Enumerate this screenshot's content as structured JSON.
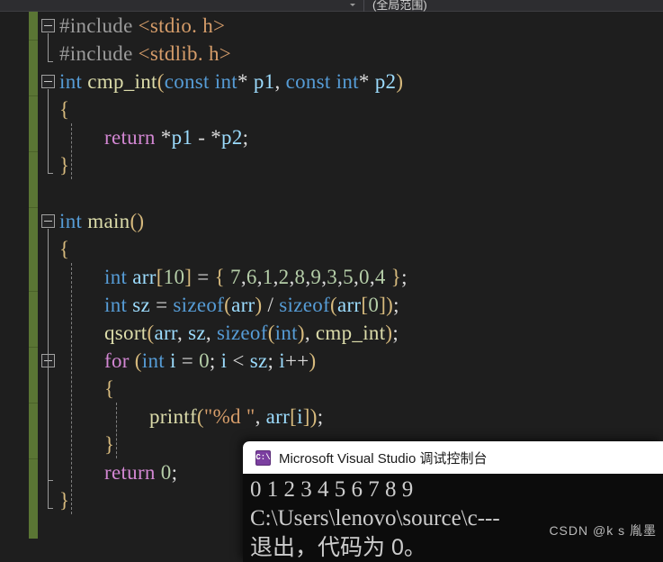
{
  "window": {
    "app": "Microsoft Visual Studio",
    "theme_background": "#1e1e1e"
  },
  "toolbar": {
    "scope_label": "(全局范围)",
    "dropdown_icon": "chevron-down-icon"
  },
  "editor": {
    "change_bar_color": "#5a7534",
    "font_size_px": 23,
    "line_height_px": 31,
    "lines": [
      {
        "n": 1,
        "indent": 0,
        "fold": "open",
        "tokens": [
          {
            "t": "pre",
            "v": "#include "
          },
          {
            "t": "str",
            "v": "<stdio. h>"
          }
        ]
      },
      {
        "n": 2,
        "indent": 0,
        "fold": "none",
        "tokens": [
          {
            "t": "pre",
            "v": "#include "
          },
          {
            "t": "str",
            "v": "<stdlib. h>"
          }
        ]
      },
      {
        "n": 3,
        "indent": 0,
        "fold": "open",
        "tokens": [
          {
            "t": "kw",
            "v": "int"
          },
          {
            "t": "plain",
            "v": " "
          },
          {
            "t": "fn",
            "v": "cmp_int"
          },
          {
            "t": "brace",
            "v": "("
          },
          {
            "t": "kw",
            "v": "const int"
          },
          {
            "t": "plain",
            "v": "* "
          },
          {
            "t": "var",
            "v": "p1"
          },
          {
            "t": "punct",
            "v": ", "
          },
          {
            "t": "kw",
            "v": "const int"
          },
          {
            "t": "plain",
            "v": "* "
          },
          {
            "t": "var",
            "v": "p2"
          },
          {
            "t": "brace",
            "v": ")"
          }
        ]
      },
      {
        "n": 4,
        "indent": 0,
        "fold": "none",
        "tokens": [
          {
            "t": "brace",
            "v": "{"
          }
        ]
      },
      {
        "n": 5,
        "indent": 1,
        "fold": "none",
        "tokens": [
          {
            "t": "ctl",
            "v": "return"
          },
          {
            "t": "plain",
            "v": " *"
          },
          {
            "t": "var",
            "v": "p1"
          },
          {
            "t": "plain",
            "v": " - *"
          },
          {
            "t": "var",
            "v": "p2"
          },
          {
            "t": "punct",
            "v": ";"
          }
        ]
      },
      {
        "n": 6,
        "indent": 0,
        "fold": "none",
        "tokens": [
          {
            "t": "brace",
            "v": "}"
          }
        ]
      },
      {
        "n": 7,
        "indent": 0,
        "fold": "none",
        "tokens": []
      },
      {
        "n": 8,
        "indent": 0,
        "fold": "open",
        "tokens": [
          {
            "t": "kw",
            "v": "int"
          },
          {
            "t": "plain",
            "v": " "
          },
          {
            "t": "fn",
            "v": "main"
          },
          {
            "t": "brace",
            "v": "()"
          }
        ]
      },
      {
        "n": 9,
        "indent": 0,
        "fold": "none",
        "tokens": [
          {
            "t": "brace",
            "v": "{"
          }
        ]
      },
      {
        "n": 10,
        "indent": 1,
        "fold": "none",
        "tokens": [
          {
            "t": "kw",
            "v": "int"
          },
          {
            "t": "plain",
            "v": " "
          },
          {
            "t": "var",
            "v": "arr"
          },
          {
            "t": "brace",
            "v": "["
          },
          {
            "t": "num",
            "v": "10"
          },
          {
            "t": "brace",
            "v": "]"
          },
          {
            "t": "plain",
            "v": " = "
          },
          {
            "t": "brace",
            "v": "{"
          },
          {
            "t": "plain",
            "v": " "
          },
          {
            "t": "num",
            "v": "7"
          },
          {
            "t": "punct",
            "v": ","
          },
          {
            "t": "num",
            "v": "6"
          },
          {
            "t": "punct",
            "v": ","
          },
          {
            "t": "num",
            "v": "1"
          },
          {
            "t": "punct",
            "v": ","
          },
          {
            "t": "num",
            "v": "2"
          },
          {
            "t": "punct",
            "v": ","
          },
          {
            "t": "num",
            "v": "8"
          },
          {
            "t": "punct",
            "v": ","
          },
          {
            "t": "num",
            "v": "9"
          },
          {
            "t": "punct",
            "v": ","
          },
          {
            "t": "num",
            "v": "3"
          },
          {
            "t": "punct",
            "v": ","
          },
          {
            "t": "num",
            "v": "5"
          },
          {
            "t": "punct",
            "v": ","
          },
          {
            "t": "num",
            "v": "0"
          },
          {
            "t": "punct",
            "v": ","
          },
          {
            "t": "num",
            "v": "4"
          },
          {
            "t": "plain",
            "v": " "
          },
          {
            "t": "brace",
            "v": "}"
          },
          {
            "t": "punct",
            "v": ";"
          }
        ]
      },
      {
        "n": 11,
        "indent": 1,
        "fold": "none",
        "tokens": [
          {
            "t": "kw",
            "v": "int"
          },
          {
            "t": "plain",
            "v": " "
          },
          {
            "t": "var",
            "v": "sz"
          },
          {
            "t": "plain",
            "v": " = "
          },
          {
            "t": "kw",
            "v": "sizeof"
          },
          {
            "t": "brace",
            "v": "("
          },
          {
            "t": "var",
            "v": "arr"
          },
          {
            "t": "brace",
            "v": ")"
          },
          {
            "t": "plain",
            "v": " / "
          },
          {
            "t": "kw",
            "v": "sizeof"
          },
          {
            "t": "brace",
            "v": "("
          },
          {
            "t": "var",
            "v": "arr"
          },
          {
            "t": "brace",
            "v": "["
          },
          {
            "t": "num",
            "v": "0"
          },
          {
            "t": "brace",
            "v": "])"
          },
          {
            "t": "punct",
            "v": ";"
          }
        ]
      },
      {
        "n": 12,
        "indent": 1,
        "fold": "none",
        "tokens": [
          {
            "t": "fn",
            "v": "qsort"
          },
          {
            "t": "brace",
            "v": "("
          },
          {
            "t": "var",
            "v": "arr"
          },
          {
            "t": "punct",
            "v": ", "
          },
          {
            "t": "var",
            "v": "sz"
          },
          {
            "t": "punct",
            "v": ", "
          },
          {
            "t": "kw",
            "v": "sizeof"
          },
          {
            "t": "brace",
            "v": "("
          },
          {
            "t": "kw",
            "v": "int"
          },
          {
            "t": "brace",
            "v": ")"
          },
          {
            "t": "punct",
            "v": ", "
          },
          {
            "t": "fn",
            "v": "cmp_int"
          },
          {
            "t": "brace",
            "v": ")"
          },
          {
            "t": "punct",
            "v": ";"
          }
        ]
      },
      {
        "n": 13,
        "indent": 1,
        "fold": "open",
        "tokens": [
          {
            "t": "ctl",
            "v": "for"
          },
          {
            "t": "plain",
            "v": " "
          },
          {
            "t": "brace",
            "v": "("
          },
          {
            "t": "kw",
            "v": "int"
          },
          {
            "t": "plain",
            "v": " "
          },
          {
            "t": "var",
            "v": "i"
          },
          {
            "t": "plain",
            "v": " = "
          },
          {
            "t": "num",
            "v": "0"
          },
          {
            "t": "punct",
            "v": "; "
          },
          {
            "t": "var",
            "v": "i"
          },
          {
            "t": "plain",
            "v": " < "
          },
          {
            "t": "var",
            "v": "sz"
          },
          {
            "t": "punct",
            "v": "; "
          },
          {
            "t": "var",
            "v": "i"
          },
          {
            "t": "plain",
            "v": "++"
          },
          {
            "t": "brace",
            "v": ")"
          }
        ]
      },
      {
        "n": 14,
        "indent": 1,
        "fold": "none",
        "tokens": [
          {
            "t": "brace",
            "v": "{"
          }
        ]
      },
      {
        "n": 15,
        "indent": 2,
        "fold": "none",
        "tokens": [
          {
            "t": "fn",
            "v": "printf"
          },
          {
            "t": "brace",
            "v": "("
          },
          {
            "t": "str",
            "v": "\"%d \""
          },
          {
            "t": "punct",
            "v": ", "
          },
          {
            "t": "var",
            "v": "arr"
          },
          {
            "t": "brace",
            "v": "["
          },
          {
            "t": "var",
            "v": "i"
          },
          {
            "t": "brace",
            "v": "])"
          },
          {
            "t": "punct",
            "v": ";"
          }
        ]
      },
      {
        "n": 16,
        "indent": 1,
        "fold": "none",
        "tokens": [
          {
            "t": "brace",
            "v": "}"
          }
        ]
      },
      {
        "n": 17,
        "indent": 1,
        "fold": "none",
        "tokens": [
          {
            "t": "ctl",
            "v": "return"
          },
          {
            "t": "plain",
            "v": " "
          },
          {
            "t": "num",
            "v": "0"
          },
          {
            "t": "punct",
            "v": ";"
          }
        ]
      },
      {
        "n": 18,
        "indent": 0,
        "fold": "none",
        "tokens": [
          {
            "t": "brace",
            "v": "}"
          }
        ]
      }
    ]
  },
  "console": {
    "icon": "console-app-icon",
    "icon_glyph": "C:\\",
    "title": "Microsoft Visual Studio 调试控制台",
    "output_lines": [
      "0 1 2 3 4 5 6 7 8 9",
      "C:\\Users\\lenovo\\source\\c---",
      "退出，代码为 0。"
    ]
  },
  "watermark": {
    "text": "CSDN @k s 胤墨"
  }
}
